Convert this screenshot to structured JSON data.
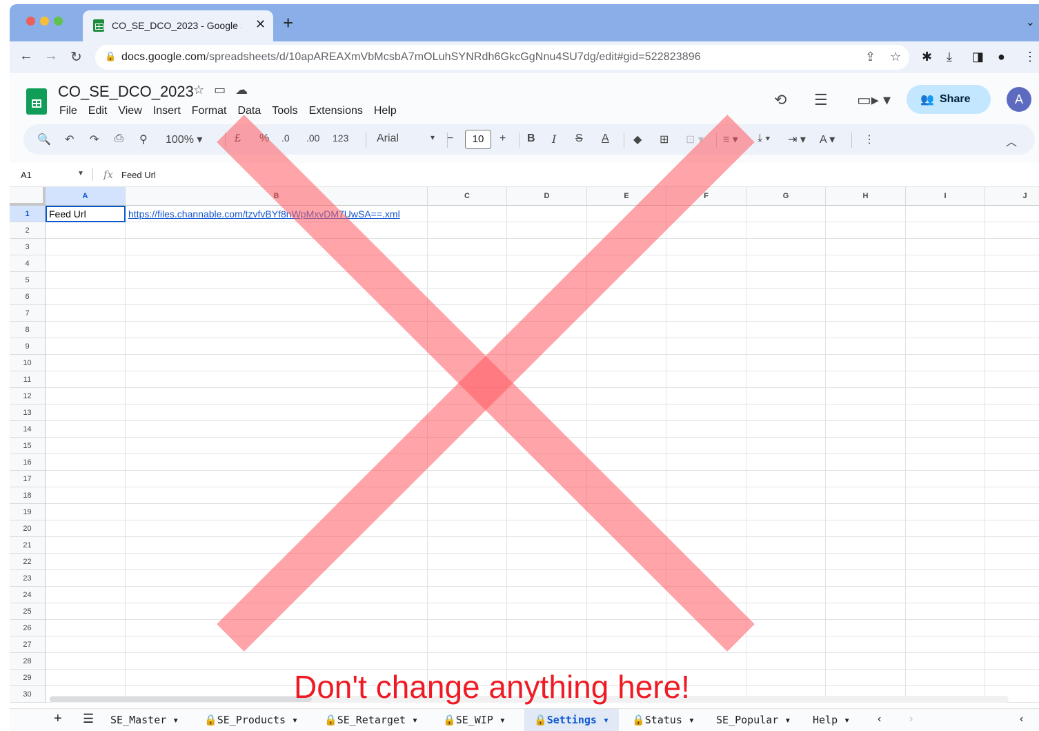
{
  "browser": {
    "tab_title": "CO_SE_DCO_2023 - Google S",
    "url_domain": "docs.google.com",
    "url_path": "/spreadsheets/d/10apAREAXmVbMcsbA7mOLuhSYNRdh6GkcGgNnu4SU7dg/edit#gid=522823896"
  },
  "sheets": {
    "doc_title": "CO_SE_DCO_2023",
    "menu": [
      "File",
      "Edit",
      "View",
      "Insert",
      "Format",
      "Data",
      "Tools",
      "Extensions",
      "Help"
    ],
    "share_label": "Share",
    "avatar_letter": "A",
    "toolbar": {
      "zoom": "100%",
      "currency": "£",
      "percent": "%",
      "dec_decrease": ".0",
      "dec_increase": ".00",
      "number_format": "123",
      "font": "Arial",
      "font_size": "10",
      "bold": "B",
      "italic": "I"
    },
    "formula": {
      "name_box": "A1",
      "fx": "fx",
      "value": "Feed Url"
    },
    "columns": [
      "A",
      "B",
      "C",
      "D",
      "E",
      "F",
      "G",
      "H",
      "I",
      "J"
    ],
    "rows": [
      "1",
      "2",
      "3",
      "4",
      "5",
      "6",
      "7",
      "8",
      "9",
      "10",
      "11",
      "12",
      "13",
      "14",
      "15",
      "16",
      "17",
      "18",
      "19",
      "20",
      "21",
      "22",
      "23",
      "24",
      "25",
      "26",
      "27",
      "28",
      "29",
      "30"
    ],
    "cells": {
      "A1": "Feed Url",
      "B1": "https://files.channable.com/tzvfvBYf8nWpMxvDM7UwSA==.xml"
    },
    "sheet_tabs": [
      "SE_Master",
      "SE_Products",
      "SE_Retarget",
      "SE_WIP",
      "Settings",
      "Status",
      "SE_Popular",
      "Help"
    ],
    "active_tab": "Settings"
  },
  "overlay": {
    "warning_text": "Don't change anything here!",
    "cross_color": "#ff5a60"
  }
}
